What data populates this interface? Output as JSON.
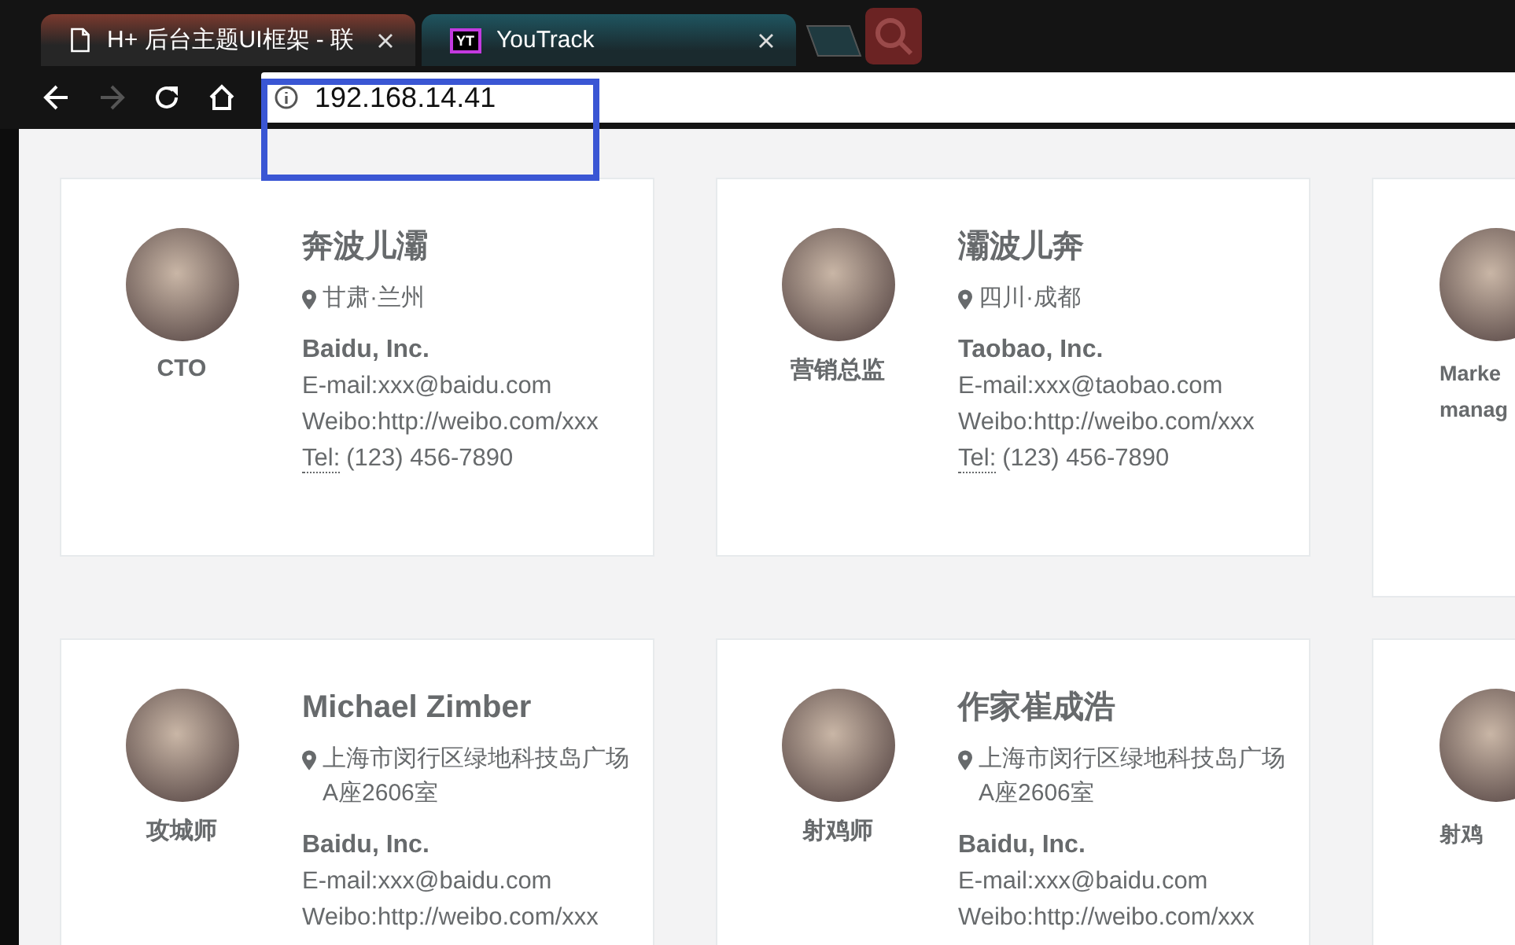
{
  "browser": {
    "tabs": [
      {
        "title": "H+ 后台主题UI框架 - 联",
        "selected": true
      },
      {
        "title": "YouTrack",
        "logo_text": "YT",
        "selected": false
      }
    ],
    "forward_disabled": true,
    "address": "192.168.14.41",
    "annotation": true
  },
  "contacts": [
    {
      "kind": "full",
      "name": "奔波儿灞",
      "location": "甘肃·兰州",
      "role": "CTO",
      "company": "Baidu, Inc.",
      "email": "E-mail:xxx@baidu.com",
      "weibo": "Weibo:http://weibo.com/xxx",
      "tel_label": "Tel:",
      "phone": "(123) 456-7890"
    },
    {
      "kind": "full",
      "name": "灞波儿奔",
      "location": "四川·成都",
      "role": "营销总监",
      "company": "Taobao, Inc.",
      "email": "E-mail:xxx@taobao.com",
      "weibo": "Weibo:http://weibo.com/xxx",
      "tel_label": "Tel:",
      "phone": "(123) 456-7890"
    },
    {
      "kind": "clipped",
      "role": "Marke manag"
    },
    {
      "kind": "full",
      "name": "Michael Zimber",
      "location": "上海市闵行区绿地科技岛广场A座2606室",
      "role": "攻城师",
      "company": "Baidu, Inc.",
      "email": "E-mail:xxx@baidu.com",
      "weibo": "Weibo:http://weibo.com/xxx"
    },
    {
      "kind": "full",
      "name": "作家崔成浩",
      "location": "上海市闵行区绿地科技岛广场A座2606室",
      "role": "射鸡师",
      "company": "Baidu, Inc.",
      "email": "E-mail:xxx@baidu.com",
      "weibo": "Weibo:http://weibo.com/xxx"
    },
    {
      "kind": "clipped",
      "role": "射鸡"
    }
  ]
}
